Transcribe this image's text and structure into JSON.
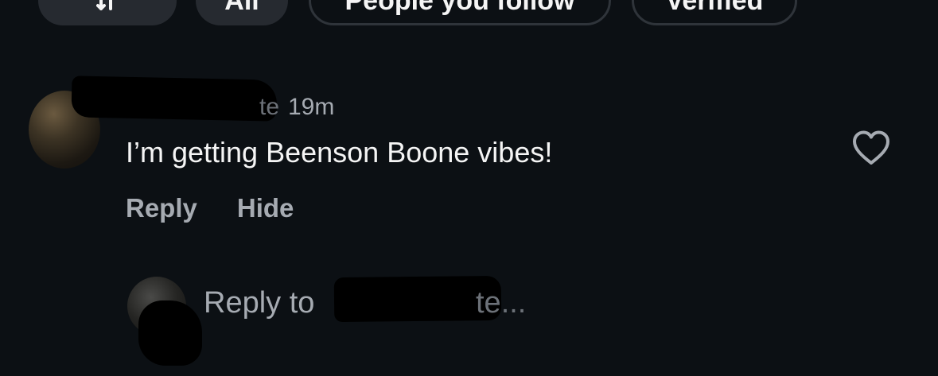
{
  "filters": {
    "chips": [
      {
        "label": "",
        "icon": "sort-icon",
        "style": "filled"
      },
      {
        "label": "All",
        "style": "filled"
      },
      {
        "label": "People you follow",
        "style": "outlined"
      },
      {
        "label": "Verified",
        "style": "outlined"
      }
    ]
  },
  "comment": {
    "username_visible_fragment": "te",
    "timestamp": "19m",
    "text": "I’m getting Beenson Boone vibes!",
    "actions": {
      "reply": "Reply",
      "hide": "Hide"
    },
    "like_icon": "heart-outline-icon"
  },
  "reply_box": {
    "placeholder_prefix": "Reply to",
    "placeholder_suffix": "te..."
  },
  "colors": {
    "background": "#0c1014",
    "primary_text": "#f5f5f5",
    "secondary_text": "#a6abb2",
    "chip_fill": "#262a30",
    "chip_border": "#2f343a"
  }
}
